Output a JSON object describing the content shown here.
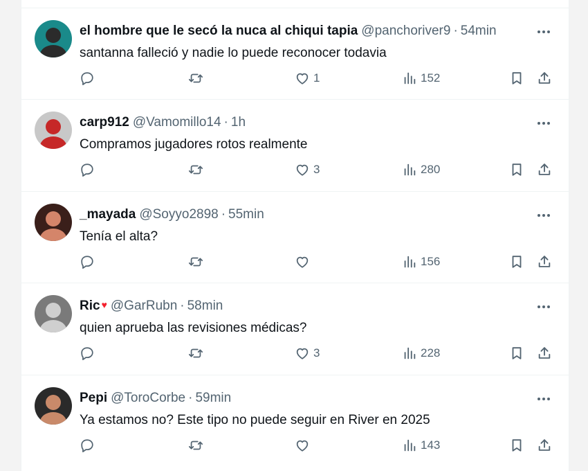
{
  "tweets": [
    {
      "display_name": "el hombre que le secó la nuca al chiqui tapia",
      "badge": "",
      "handle": "@panchoriver9",
      "separator": "·",
      "time": "54min",
      "text": "santanna falleció y nadie lo puede reconocer todavia",
      "replies": "",
      "retweets": "",
      "likes": "1",
      "views": "152",
      "avatar_colors": [
        "#1a8a8a",
        "#2b2b2b"
      ]
    },
    {
      "display_name": "carp912",
      "badge": "",
      "handle": "@Vamomillo14",
      "separator": "·",
      "time": "1h",
      "text": "Compramos jugadores rotos realmente",
      "replies": "",
      "retweets": "",
      "likes": "3",
      "views": "280",
      "avatar_colors": [
        "#c8c8c8",
        "#c62828"
      ]
    },
    {
      "display_name": "_mayada",
      "badge": "",
      "handle": "@Soyyo2898",
      "separator": "·",
      "time": "55min",
      "text": "Tenía el alta?",
      "replies": "",
      "retweets": "",
      "likes": "",
      "views": "156",
      "avatar_colors": [
        "#3a1f1a",
        "#d4856a"
      ]
    },
    {
      "display_name": "Ric",
      "badge": "♥",
      "handle": "@GarRubn",
      "separator": "·",
      "time": "58min",
      "text": "quien aprueba las revisiones médicas?",
      "replies": "",
      "retweets": "",
      "likes": "3",
      "views": "228",
      "avatar_colors": [
        "#7a7a7a",
        "#cfcfcf"
      ]
    },
    {
      "display_name": "Pepi",
      "badge": "",
      "handle": "@ToroCorbe",
      "separator": "·",
      "time": "59min",
      "text": "Ya estamos no? Este tipo no puede seguir en River en 2025",
      "replies": "",
      "retweets": "",
      "likes": "",
      "views": "143",
      "avatar_colors": [
        "#2a2a2a",
        "#c98a6a"
      ]
    }
  ],
  "icons": {
    "reply": "reply-icon",
    "retweet": "retweet-icon",
    "like": "heart-icon",
    "views": "views-chart-icon",
    "bookmark": "bookmark-icon",
    "share": "share-icon",
    "more": "more-horizontal-icon"
  },
  "colors": {
    "text": "#0f1419",
    "secondary": "#536471",
    "divider": "#eff3f4",
    "badge": "#f4212e"
  }
}
